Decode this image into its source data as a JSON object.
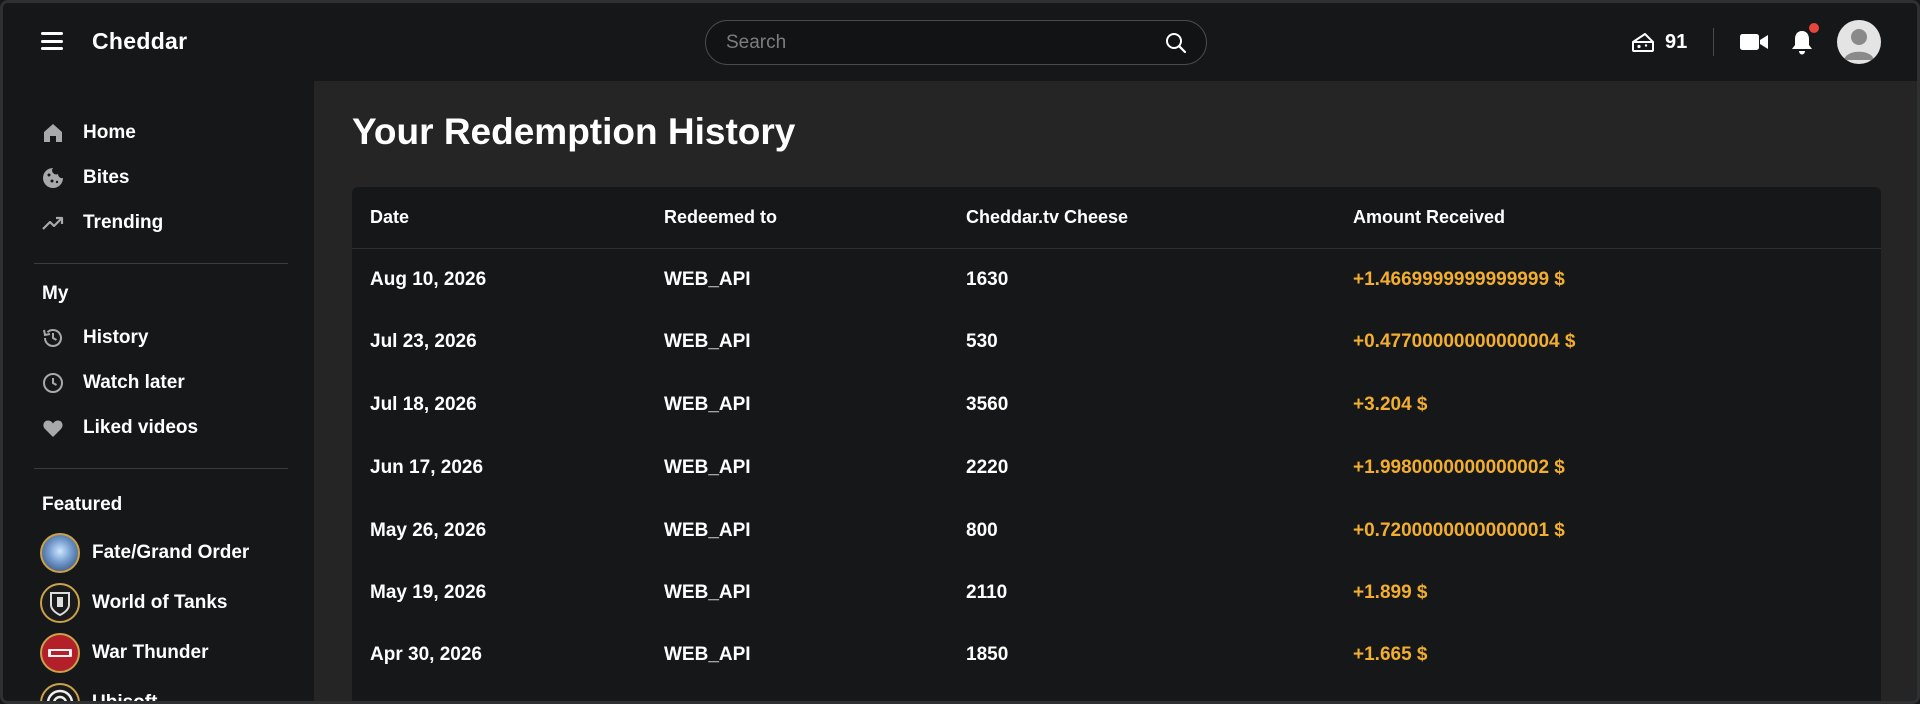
{
  "header": {
    "logo": "Cheddar",
    "search_placeholder": "Search",
    "cheese_count": "91"
  },
  "sidebar": {
    "main_items": [
      {
        "label": "Home",
        "icon": "home-icon"
      },
      {
        "label": "Bites",
        "icon": "cookie-icon"
      },
      {
        "label": "Trending",
        "icon": "trending-icon"
      }
    ],
    "my_title": "My",
    "my_items": [
      {
        "label": "History",
        "icon": "history-icon"
      },
      {
        "label": "Watch later",
        "icon": "clock-icon"
      },
      {
        "label": "Liked videos",
        "icon": "heart-icon"
      }
    ],
    "featured_title": "Featured",
    "featured_items": [
      {
        "label": "Fate/Grand Order",
        "icon": "fate-grand-order-logo-icon"
      },
      {
        "label": "World of Tanks",
        "icon": "world-of-tanks-logo-icon"
      },
      {
        "label": "War Thunder",
        "icon": "war-thunder-logo-icon"
      },
      {
        "label": "Ubisoft",
        "icon": "ubisoft-logo-icon"
      }
    ]
  },
  "main": {
    "title": "Your Redemption History",
    "columns": [
      "Date",
      "Redeemed to",
      "Cheddar.tv Cheese",
      "Amount Received"
    ],
    "rows": [
      {
        "date": "Aug 10, 2026",
        "redeemed_to": "WEB_API",
        "cheese": "1630",
        "amount": "+1.4669999999999999 $"
      },
      {
        "date": "Jul 23, 2026",
        "redeemed_to": "WEB_API",
        "cheese": "530",
        "amount": "+0.47700000000000004 $"
      },
      {
        "date": "Jul 18, 2026",
        "redeemed_to": "WEB_API",
        "cheese": "3560",
        "amount": "+3.204 $"
      },
      {
        "date": "Jun 17, 2026",
        "redeemed_to": "WEB_API",
        "cheese": "2220",
        "amount": "+1.9980000000000002 $"
      },
      {
        "date": "May 26, 2026",
        "redeemed_to": "WEB_API",
        "cheese": "800",
        "amount": "+0.7200000000000001 $"
      },
      {
        "date": "May 19, 2026",
        "redeemed_to": "WEB_API",
        "cheese": "2110",
        "amount": "+1.899 $"
      },
      {
        "date": "Apr 30, 2026",
        "redeemed_to": "WEB_API",
        "cheese": "1850",
        "amount": "+1.665 $"
      }
    ]
  },
  "colors": {
    "accent_amount": "#f2ae2e",
    "notification_dot": "#e8463c",
    "background": "#171819",
    "main_bg": "#252526"
  }
}
